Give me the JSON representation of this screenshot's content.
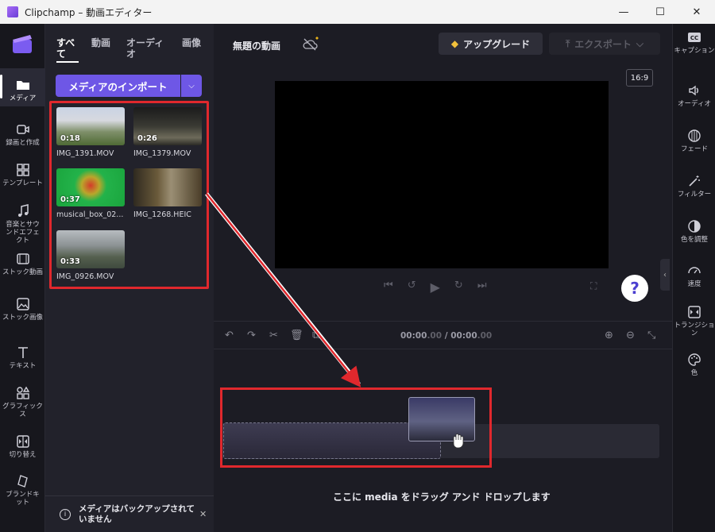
{
  "window": {
    "title": "Clipchamp – 動画エディター"
  },
  "nav": {
    "items": [
      {
        "label": "メディア"
      },
      {
        "label": "録画と作成"
      },
      {
        "label": "テンプレート"
      },
      {
        "label": "音楽とサウンドエフェクト"
      },
      {
        "label": "ストック動画"
      },
      {
        "label": "ストック画像"
      },
      {
        "label": "テキスト"
      },
      {
        "label": "グラフィックス"
      },
      {
        "label": "切り替え"
      },
      {
        "label": "ブランドキット"
      }
    ]
  },
  "media": {
    "tabs": [
      "すべて",
      "動画",
      "オーディオ",
      "画像"
    ],
    "import_label": "メディアのインポート",
    "items": [
      {
        "name": "IMG_1391.MOV",
        "duration": "0:18"
      },
      {
        "name": "IMG_1379.MOV",
        "duration": "0:26"
      },
      {
        "name": "musical_box_02...",
        "duration": "0:37"
      },
      {
        "name": "IMG_1268.HEIC",
        "duration": ""
      },
      {
        "name": "IMG_0926.MOV",
        "duration": "0:33"
      }
    ],
    "backup_msg": "メディアはバックアップされていません"
  },
  "header": {
    "project_title": "無題の動画",
    "upgrade_label": "アップグレード",
    "export_label": "エクスポート",
    "aspect_ratio": "16:9"
  },
  "timeline": {
    "current_time": "00:00",
    "current_frac": ".00",
    "separator": " / ",
    "total_time": "00:00",
    "total_frac": ".00",
    "drop_hint": "ここに media をドラッグ アンド ドロップします"
  },
  "right": {
    "items": [
      {
        "label": "キャプション"
      },
      {
        "label": "オーディオ"
      },
      {
        "label": "フェード"
      },
      {
        "label": "フィルター"
      },
      {
        "label": "色を調整"
      },
      {
        "label": "速度"
      },
      {
        "label": "トランジション"
      },
      {
        "label": "色"
      }
    ]
  },
  "colors": {
    "accent": "#6e57e6",
    "highlight": "#e0282d"
  }
}
